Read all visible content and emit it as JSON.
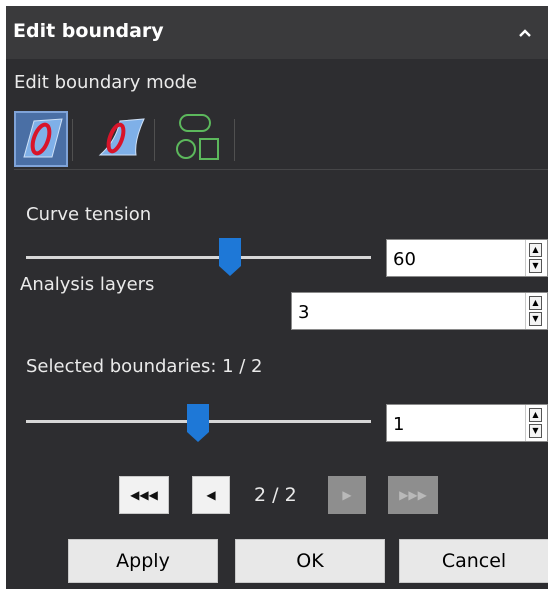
{
  "header": {
    "title": "Edit boundary",
    "collapse_icon": "chevron-up-icon"
  },
  "mode": {
    "label": "Edit boundary mode",
    "buttons": [
      {
        "icon": "boundary-surface-edit-icon",
        "active": true
      },
      {
        "icon": "boundary-edge-edit-icon",
        "active": false
      },
      {
        "icon": "boundary-shapes-icon",
        "active": false
      }
    ]
  },
  "curve_tension": {
    "label": "Curve tension",
    "value": "60",
    "slider_fraction": 0.6
  },
  "analysis_layers": {
    "label": "Analysis layers",
    "value": "3"
  },
  "selected_boundaries": {
    "label": "Selected boundaries: 1 / 2",
    "value": "1",
    "slider_fraction": 0.5
  },
  "pager": {
    "text": "2 / 2"
  },
  "actions": {
    "apply": "Apply",
    "ok": "OK",
    "cancel": "Cancel"
  },
  "colors": {
    "panel_bg": "#2d2d30",
    "header_bg": "#3a3a3c",
    "accent": "#1e78d7",
    "active_mode": "#4a6fa5"
  }
}
